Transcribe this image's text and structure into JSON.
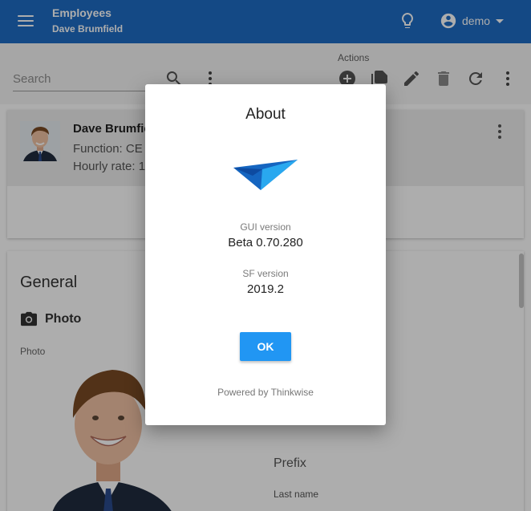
{
  "header": {
    "title": "Employees",
    "subtitle": "Dave Brumfield",
    "user_name": "demo",
    "colors": {
      "app_bar": "#1e6cc4",
      "accent": "#2196f3"
    }
  },
  "toolbar": {
    "search_placeholder": "Search",
    "actions_label": "Actions",
    "icons": [
      "search-icon",
      "more-vert-icon",
      "add-circle-icon",
      "copy-icon",
      "edit-icon",
      "delete-icon",
      "refresh-icon",
      "more-vert-icon"
    ]
  },
  "employee_card": {
    "name": "Dave Brumfie",
    "function": "Function: CE",
    "hourly_rate": "Hourly rate: 1"
  },
  "form": {
    "section_title": "General",
    "photo_group": "Photo",
    "photo_label": "Photo",
    "prefix_label": "Prefix",
    "last_name_label": "Last name"
  },
  "about_dialog": {
    "title": "About",
    "gui_version_label": "GUI version",
    "gui_version": "Beta 0.70.280",
    "sf_version_label": "SF version",
    "sf_version": "2019.2",
    "ok_label": "OK",
    "powered_by": "Powered by Thinkwise"
  }
}
